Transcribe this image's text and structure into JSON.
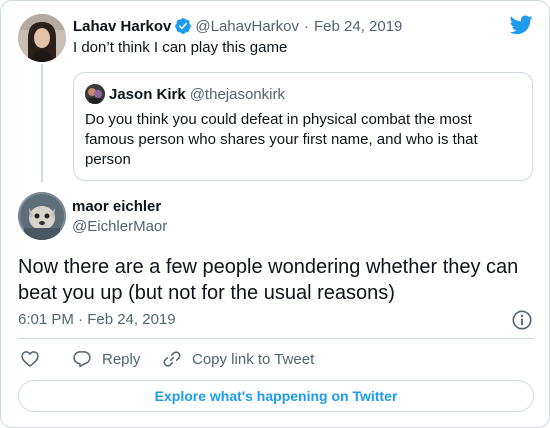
{
  "parent_tweet": {
    "author_name": "Lahav Harkov",
    "author_handle": "@LahavHarkov",
    "separator": "·",
    "date": "Feb 24, 2019",
    "text": "I don’t think I can play this game"
  },
  "quoted_tweet": {
    "author_name": "Jason Kirk",
    "author_handle": "@thejasonkirk",
    "text": "Do you think you could defeat in physical combat the most famous person who shares your first name, and who is that person"
  },
  "main_tweet": {
    "author_name": "maor eichler",
    "author_handle": "@EichlerMaor",
    "text": "Now there are a few people wondering whether they can beat you up (but not for the usual reasons)",
    "timestamp": "6:01 PM · Feb 24, 2019"
  },
  "actions": {
    "reply_label": "Reply",
    "copy_link_label": "Copy link to Tweet"
  },
  "explore_button": {
    "label": "Explore what's happening on Twitter"
  },
  "colors": {
    "brand": "#1d9bf0",
    "text_primary": "#0f1419",
    "text_secondary": "#536471",
    "border": "#cfd9de"
  },
  "icons": [
    "verified-icon",
    "twitter-logo-icon",
    "info-icon",
    "heart-icon",
    "reply-icon",
    "copy-link-icon"
  ]
}
